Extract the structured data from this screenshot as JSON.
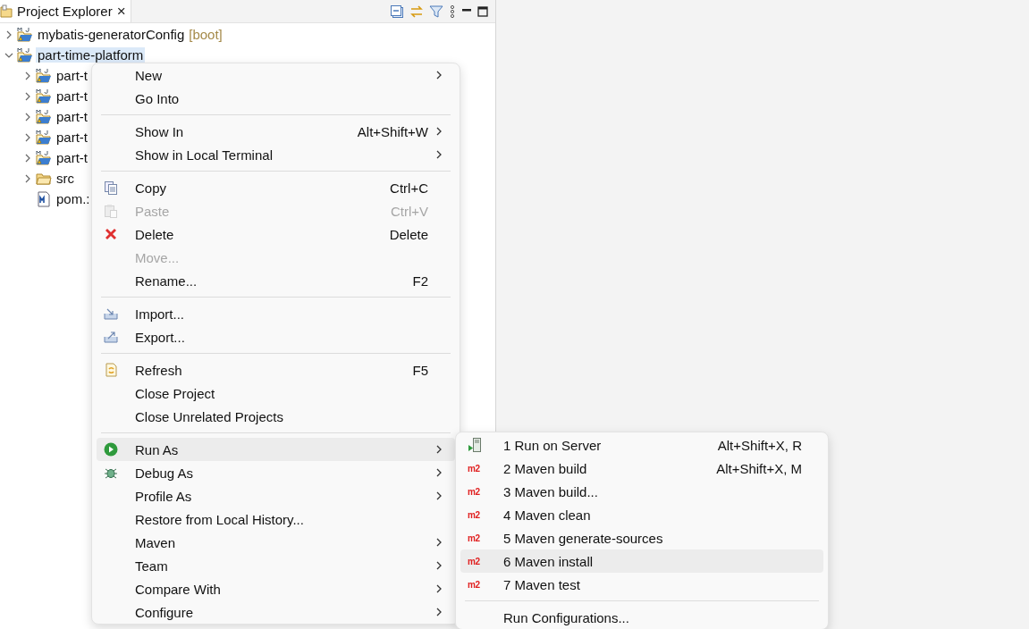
{
  "explorer": {
    "title": "Project Explorer",
    "close": "×",
    "tree": [
      {
        "kind": "project",
        "label": "mybatis-generatorConfig",
        "tag": "[boot]",
        "expanded": false,
        "selected": false
      },
      {
        "kind": "project",
        "label": "part-time-platform",
        "expanded": true,
        "selected": true,
        "children": [
          {
            "kind": "project",
            "label": "part-t",
            "expanded": false,
            "selected": false
          },
          {
            "kind": "project",
            "label": "part-t",
            "expanded": false,
            "selected": false
          },
          {
            "kind": "project",
            "label": "part-t",
            "expanded": false,
            "selected": false
          },
          {
            "kind": "project",
            "label": "part-t",
            "expanded": false,
            "selected": false
          },
          {
            "kind": "project",
            "label": "part-t",
            "expanded": false,
            "selected": false
          },
          {
            "kind": "folder",
            "label": "src",
            "expanded": false,
            "selected": false
          },
          {
            "kind": "file",
            "label": "pom.:",
            "selected": false
          }
        ]
      }
    ]
  },
  "context_menu": [
    {
      "kind": "item",
      "label": "New",
      "submenu": true,
      "disabled": false,
      "selected": false
    },
    {
      "kind": "item",
      "label": "Go Into",
      "submenu": false,
      "disabled": false,
      "selected": false
    },
    {
      "kind": "separator"
    },
    {
      "kind": "item",
      "label": "Show In",
      "shortcut": "Alt+Shift+W",
      "submenu": true,
      "disabled": false,
      "selected": false
    },
    {
      "kind": "item",
      "label": "Show in Local Terminal",
      "submenu": true,
      "disabled": false,
      "selected": false
    },
    {
      "kind": "separator"
    },
    {
      "kind": "item",
      "label": "Copy",
      "shortcut": "Ctrl+C",
      "submenu": false,
      "disabled": false,
      "selected": false
    },
    {
      "kind": "item",
      "label": "Paste",
      "shortcut": "Ctrl+V",
      "submenu": false,
      "disabled": true,
      "selected": false
    },
    {
      "kind": "item",
      "label": "Delete",
      "shortcut": "Delete",
      "submenu": false,
      "disabled": false,
      "selected": false
    },
    {
      "kind": "item",
      "label": "Move...",
      "submenu": false,
      "disabled": true,
      "selected": false
    },
    {
      "kind": "item",
      "label": "Rename...",
      "shortcut": "F2",
      "submenu": false,
      "disabled": false,
      "selected": false
    },
    {
      "kind": "separator"
    },
    {
      "kind": "item",
      "label": "Import...",
      "submenu": false,
      "disabled": false,
      "selected": false
    },
    {
      "kind": "item",
      "label": "Export...",
      "submenu": false,
      "disabled": false,
      "selected": false
    },
    {
      "kind": "separator"
    },
    {
      "kind": "item",
      "label": "Refresh",
      "shortcut": "F5",
      "submenu": false,
      "disabled": false,
      "selected": false
    },
    {
      "kind": "item",
      "label": "Close Project",
      "submenu": false,
      "disabled": false,
      "selected": false
    },
    {
      "kind": "item",
      "label": "Close Unrelated Projects",
      "submenu": false,
      "disabled": false,
      "selected": false
    },
    {
      "kind": "separator"
    },
    {
      "kind": "item",
      "label": "Run As",
      "submenu": true,
      "disabled": false,
      "selected": true
    },
    {
      "kind": "item",
      "label": "Debug As",
      "submenu": true,
      "disabled": false,
      "selected": false
    },
    {
      "kind": "item",
      "label": "Profile As",
      "submenu": true,
      "disabled": false,
      "selected": false
    },
    {
      "kind": "item",
      "label": "Restore from Local History...",
      "submenu": false,
      "disabled": false,
      "selected": false
    },
    {
      "kind": "item",
      "label": "Maven",
      "submenu": true,
      "disabled": false,
      "selected": false
    },
    {
      "kind": "item",
      "label": "Team",
      "submenu": true,
      "disabled": false,
      "selected": false
    },
    {
      "kind": "item",
      "label": "Compare With",
      "submenu": true,
      "disabled": false,
      "selected": false
    },
    {
      "kind": "item",
      "label": "Configure",
      "submenu": true,
      "disabled": false,
      "selected": false
    }
  ],
  "run_as_menu": [
    {
      "kind": "item",
      "label": "1 Run on Server",
      "shortcut": "Alt+Shift+X, R",
      "selected": false
    },
    {
      "kind": "item",
      "label": "2 Maven build",
      "badge": "m2",
      "shortcut": "Alt+Shift+X, M",
      "selected": false
    },
    {
      "kind": "item",
      "label": "3 Maven build...",
      "badge": "m2",
      "selected": false
    },
    {
      "kind": "item",
      "label": "4 Maven clean",
      "badge": "m2",
      "selected": false
    },
    {
      "kind": "item",
      "label": "5 Maven generate-sources",
      "badge": "m2",
      "selected": false
    },
    {
      "kind": "item",
      "label": "6 Maven install",
      "badge": "m2",
      "selected": true
    },
    {
      "kind": "item",
      "label": "7 Maven test",
      "badge": "m2",
      "selected": false
    },
    {
      "kind": "separator"
    },
    {
      "kind": "item",
      "label": "Run Configurations...",
      "selected": false
    }
  ]
}
